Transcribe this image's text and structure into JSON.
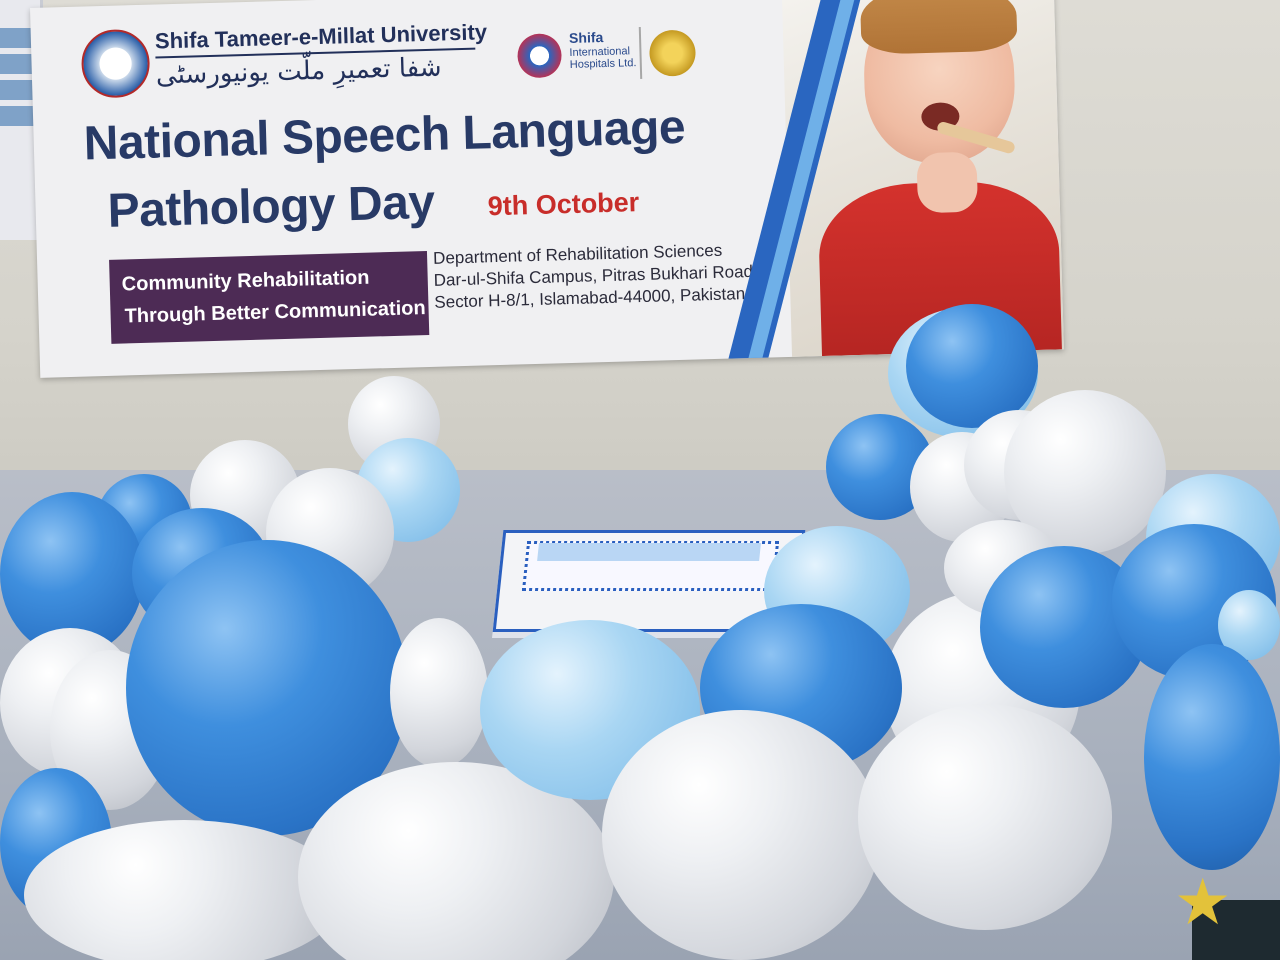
{
  "banner": {
    "university_name": "Shifa Tameer-e-Millat University",
    "university_urdu": "شفا تعمیرِ ملّت یونیورسٹی",
    "hospital_name": "Shifa",
    "hospital_sub": "International Hospitals Ltd.",
    "title_line1": "National Speech Language",
    "title_line2": "Pathology Day",
    "date": "9th October",
    "tagline_line1": "Community Rehabilitation",
    "tagline_line2": "Through Better Communication",
    "address_line1": "Department of Rehabilitation Sciences",
    "address_line2": "Dar-ul-Shifa Campus, Pitras Bukhari Road",
    "address_line3": "Sector H-8/1, Islamabad-44000, Pakistan"
  },
  "colors": {
    "title": "#283a66",
    "date": "#c82d2a",
    "tagline_box": "#4d2b55",
    "balloon_blue": "#2a73c6",
    "balloon_light_blue": "#87c1ea",
    "balloon_white": "#d3d6dc"
  },
  "icons": [
    "university-logo-icon",
    "hospital-logo-icon",
    "gold-seal-icon",
    "star-icon"
  ]
}
